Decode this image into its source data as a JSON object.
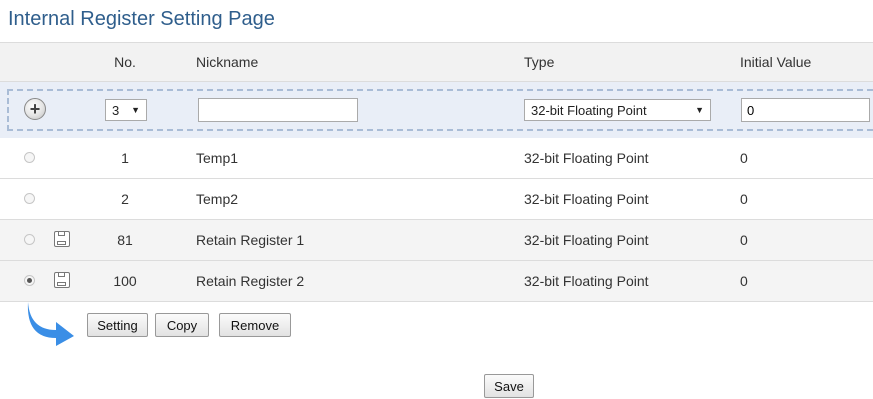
{
  "page": {
    "title": "Internal Register Setting Page"
  },
  "columns": {
    "no": "No.",
    "nickname": "Nickname",
    "type": "Type",
    "initial_value": "Initial Value"
  },
  "add_row": {
    "count_select": "3",
    "nickname_value": "",
    "type_select": "32-bit Floating Point",
    "initial_value": "0"
  },
  "rows": [
    {
      "no": "1",
      "nickname": "Temp1",
      "type": "32-bit Floating Point",
      "initial": "0",
      "selected": false,
      "retain": false
    },
    {
      "no": "2",
      "nickname": "Temp2",
      "type": "32-bit Floating Point",
      "initial": "0",
      "selected": false,
      "retain": false
    },
    {
      "no": "81",
      "nickname": "Retain Register 1",
      "type": "32-bit Floating Point",
      "initial": "0",
      "selected": false,
      "retain": true
    },
    {
      "no": "100",
      "nickname": "Retain Register 2",
      "type": "32-bit Floating Point",
      "initial": "0",
      "selected": true,
      "retain": true
    }
  ],
  "actions": {
    "setting": "Setting",
    "copy": "Copy",
    "remove": "Remove",
    "save": "Save"
  },
  "icons": {
    "add": "plus-circle-icon",
    "retain": "save-icon",
    "arrow": "curved-arrow-icon"
  },
  "colors": {
    "title": "#2f5e8c",
    "arrow": "#3a8ee6",
    "add_row_bg": "#e9eef7"
  }
}
